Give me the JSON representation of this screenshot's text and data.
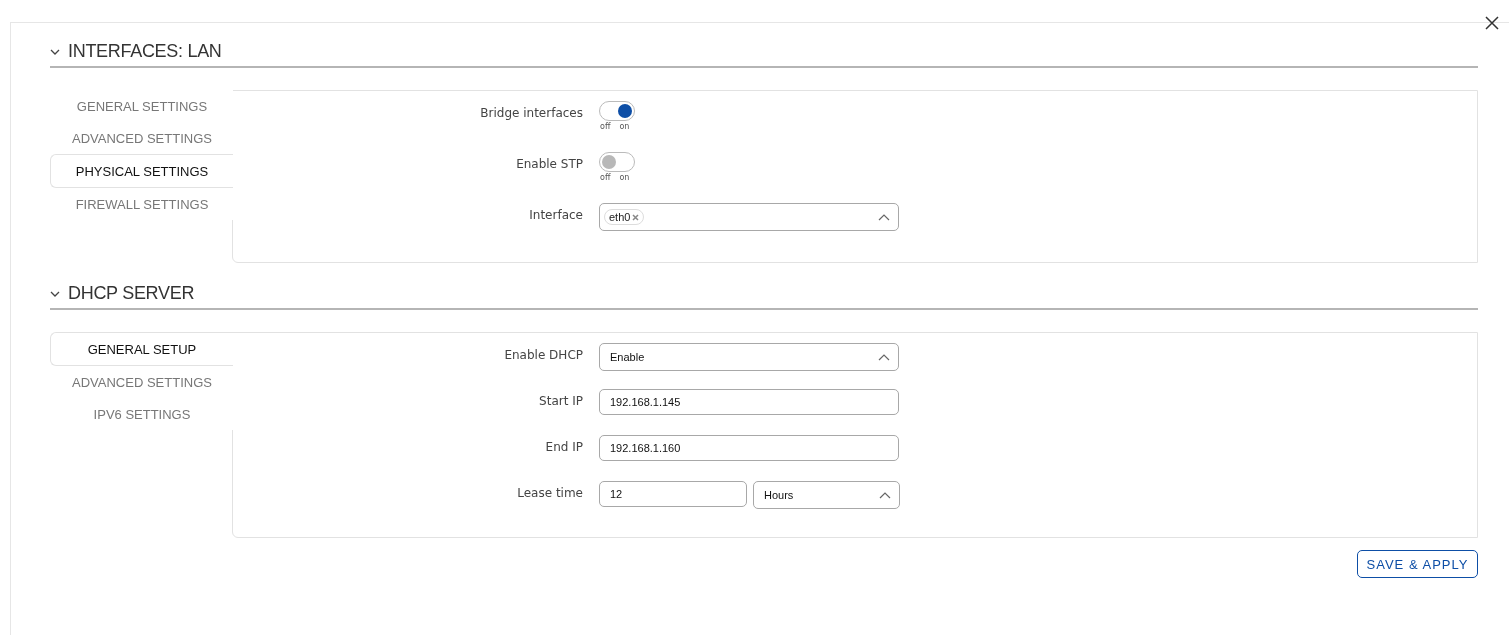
{
  "sections": [
    {
      "title": "INTERFACES: LAN",
      "expanded": true,
      "tabs": [
        {
          "label": "GENERAL SETTINGS",
          "selected": false
        },
        {
          "label": "ADVANCED SETTINGS",
          "selected": false
        },
        {
          "label": "PHYSICAL SETTINGS",
          "selected": true
        },
        {
          "label": "FIREWALL SETTINGS",
          "selected": false
        }
      ],
      "fields": [
        {
          "kind": "toggle",
          "label": "Bridge interfaces",
          "on": true,
          "off_label": "off",
          "on_label": "on"
        },
        {
          "kind": "toggle",
          "label": "Enable STP",
          "on": false,
          "off_label": "off",
          "on_label": "on"
        },
        {
          "kind": "multiselect",
          "label": "Interface",
          "chips": [
            "eth0"
          ]
        }
      ]
    },
    {
      "title": "DHCP SERVER",
      "expanded": true,
      "tabs": [
        {
          "label": "GENERAL SETUP",
          "selected": true
        },
        {
          "label": "ADVANCED SETTINGS",
          "selected": false
        },
        {
          "label": "IPV6 SETTINGS",
          "selected": false
        }
      ],
      "fields": [
        {
          "kind": "select",
          "label": "Enable DHCP",
          "value": "Enable"
        },
        {
          "kind": "text",
          "label": "Start IP",
          "value": "192.168.1.145"
        },
        {
          "kind": "text",
          "label": "End IP",
          "value": "192.168.1.160"
        },
        {
          "kind": "text_select",
          "label": "Lease time",
          "value": "12",
          "unit": "Hours"
        }
      ]
    }
  ],
  "save_button": "SAVE & APPLY"
}
